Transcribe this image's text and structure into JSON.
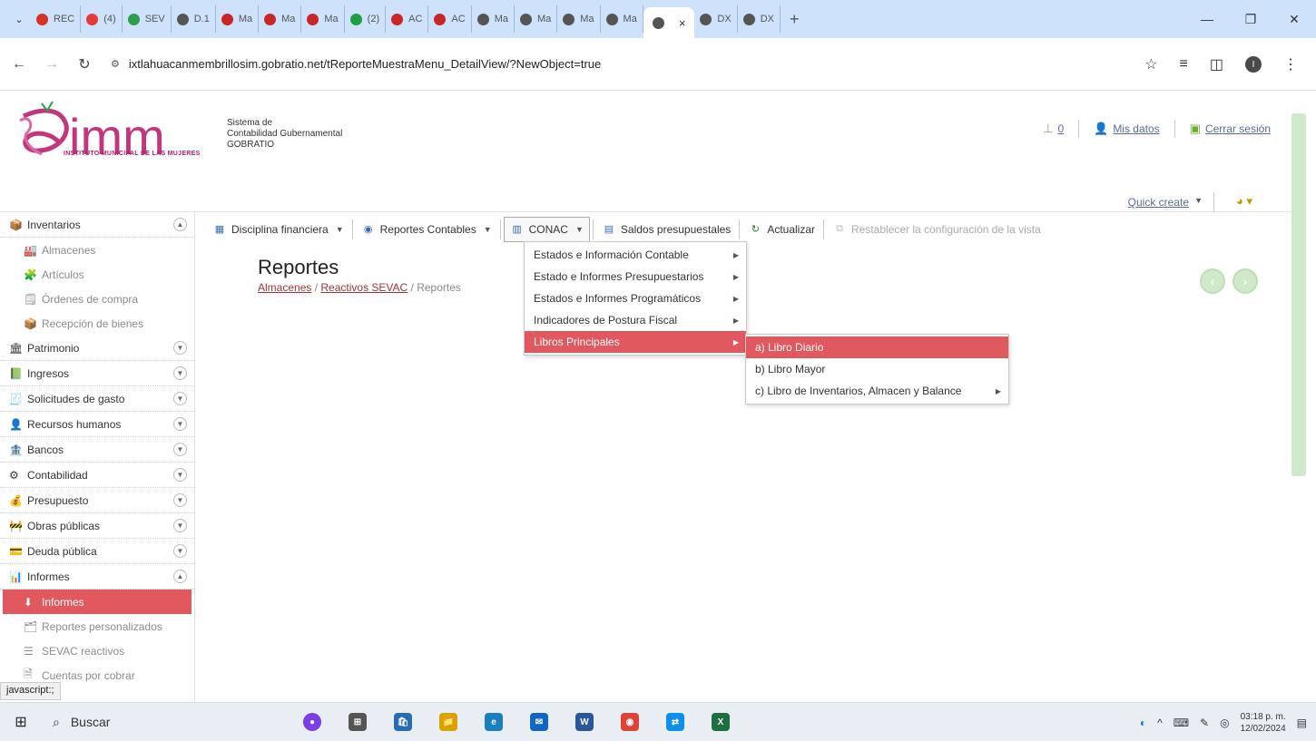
{
  "browser": {
    "tabs": [
      {
        "label": "REC",
        "color": "#d93025"
      },
      {
        "label": "(4)",
        "color": "#e53935"
      },
      {
        "label": "SEV",
        "color": "#2e9d4f"
      },
      {
        "label": "D.1",
        "color": "#555555"
      },
      {
        "label": "Ma",
        "color": "#c62828"
      },
      {
        "label": "Ma",
        "color": "#c62828"
      },
      {
        "label": "Ma",
        "color": "#c62828"
      },
      {
        "label": "(2)",
        "color": "#1e9e45"
      },
      {
        "label": "AC",
        "color": "#c62828"
      },
      {
        "label": "AC",
        "color": "#c62828"
      },
      {
        "label": "Ma",
        "color": "#555555"
      },
      {
        "label": "Ma",
        "color": "#555555"
      },
      {
        "label": "Ma",
        "color": "#555555"
      },
      {
        "label": "Ma",
        "color": "#555555"
      }
    ],
    "active_tab": {
      "label": "",
      "close": "×"
    },
    "tabs_after": [
      {
        "label": "DX",
        "color": "#555555"
      },
      {
        "label": "DX",
        "color": "#555555"
      }
    ],
    "new_tab": "+",
    "window_controls": {
      "minimize": "—",
      "restore": "❐",
      "close": "✕"
    },
    "url": "ixtlahuacanmembrillosim.gobratio.net/tReporteMuestraMenu_DetailView/?NewObject=true",
    "profile_initial": "I"
  },
  "header": {
    "logo_text": "imm",
    "logo_subtitle": "INSTITUTO MUNICIPAL DE LAS MUJERES",
    "sistema_lines": [
      "Sistema de",
      "Contabilidad Gubernamental",
      "GOBRATIO"
    ],
    "notifications_count": "0",
    "mis_datos": "Mis datos",
    "cerrar_sesion": "Cerrar sesión",
    "quick_create": "Quick create"
  },
  "sidebar": {
    "groups": [
      {
        "label": "Inventarios",
        "icon": "📦",
        "expanded": true,
        "items": [
          {
            "label": "Almacenes",
            "icon": "🏭"
          },
          {
            "label": "Artículos",
            "icon": "🧩"
          },
          {
            "label": "Órdenes de compra",
            "icon": "🗒"
          },
          {
            "label": "Recepción de bienes",
            "icon": "📦"
          }
        ]
      },
      {
        "label": "Patrimonio",
        "icon": "🏛",
        "expanded": false
      },
      {
        "label": "Ingresos",
        "icon": "📗",
        "expanded": false
      },
      {
        "label": "Solicitudes de gasto",
        "icon": "🧾",
        "expanded": false
      },
      {
        "label": "Recursos humanos",
        "icon": "👤",
        "expanded": false
      },
      {
        "label": "Bancos",
        "icon": "🏦",
        "expanded": false
      },
      {
        "label": "Contabilidad",
        "icon": "⚙",
        "expanded": false
      },
      {
        "label": "Presupuesto",
        "icon": "💰",
        "expanded": false
      },
      {
        "label": "Obras públicas",
        "icon": "🚧",
        "expanded": false
      },
      {
        "label": "Deuda pública",
        "icon": "💳",
        "expanded": false
      },
      {
        "label": "Informes",
        "icon": "📊",
        "expanded": true,
        "items": [
          {
            "label": "Informes",
            "icon": "⬇",
            "active": true
          },
          {
            "label": "Reportes personalizados",
            "icon": "🗂"
          },
          {
            "label": "SEVAC reactivos",
            "icon": "☰"
          },
          {
            "label": "Cuentas por cobrar",
            "icon": "🗎"
          }
        ]
      }
    ],
    "status_url": "javascript:;"
  },
  "toolbar": {
    "items": [
      {
        "label": "Disciplina financiera",
        "icon": "▦",
        "caret": true
      },
      {
        "label": "Reportes Contables",
        "icon": "◉",
        "caret": true
      },
      {
        "label": "CONAC",
        "icon": "▥",
        "caret": true,
        "open": true
      },
      {
        "label": "Saldos presupuestales",
        "icon": "▤",
        "caret": false
      },
      {
        "label": "Actualizar",
        "icon": "↻",
        "caret": false
      },
      {
        "label": "Restablecer la configuración de la vista",
        "icon": "⧉",
        "caret": false,
        "disabled": true
      }
    ]
  },
  "content": {
    "title": "Reportes",
    "breadcrumb": {
      "link1": "Almacenes",
      "sep": " / ",
      "link2": "Reactivos SEVAC",
      "current": "Reportes"
    },
    "prev_icon": "‹",
    "next_icon": "›"
  },
  "conac_menu": {
    "items": [
      {
        "label": "Estados e Información Contable",
        "submenu": true
      },
      {
        "label": "Estado e Informes Presupuestarios",
        "submenu": true
      },
      {
        "label": "Estados e Informes Programáticos",
        "submenu": true
      },
      {
        "label": "Indicadores de Postura Fiscal",
        "submenu": true
      },
      {
        "label": "Libros Principales",
        "submenu": true,
        "highlighted": true
      }
    ]
  },
  "libros_menu": {
    "items": [
      {
        "label": "a) Libro Diario",
        "submenu": false,
        "highlighted": true
      },
      {
        "label": "b) Libro Mayor",
        "submenu": false
      },
      {
        "label": "c) Libro de Inventarios, Almacen y Balance",
        "submenu": true
      }
    ]
  },
  "taskbar": {
    "search_label": "Buscar",
    "apps": [
      {
        "name": "copilot-app",
        "glyph": "●",
        "color": "#7b3fe4"
      },
      {
        "name": "task-view-app",
        "glyph": "⊞",
        "color": "#555555"
      },
      {
        "name": "store-app",
        "glyph": "🛍",
        "color": "#2b6cb0"
      },
      {
        "name": "file-explorer-app",
        "glyph": "📁",
        "color": "#d8a200"
      },
      {
        "name": "edge-app",
        "glyph": "e",
        "color": "#1b7fbd"
      },
      {
        "name": "mail-app",
        "glyph": "✉",
        "color": "#1565c0"
      },
      {
        "name": "word-app",
        "glyph": "W",
        "color": "#2b579a"
      },
      {
        "name": "chrome-app",
        "glyph": "◉",
        "color": "#db4437"
      },
      {
        "name": "teamviewer-app",
        "glyph": "⇄",
        "color": "#0e8ee9"
      },
      {
        "name": "excel-app",
        "glyph": "X",
        "color": "#1d6f42"
      }
    ],
    "time": "03:18 p. m.",
    "date": "12/02/2024"
  }
}
